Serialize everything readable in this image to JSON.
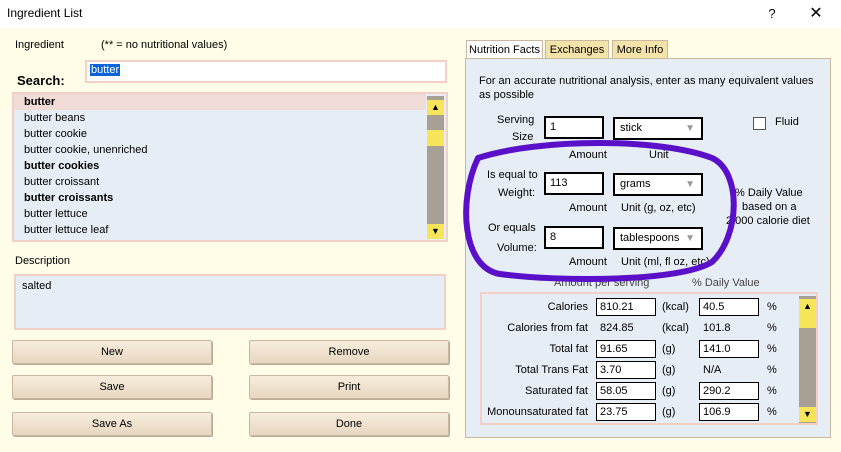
{
  "window": {
    "title": "Ingredient List",
    "help": "?",
    "close": "✕"
  },
  "ingredient_label": "Ingredient",
  "no_values_note": "(** =  no nutritional values)",
  "search_label": "Search:",
  "search_value": "butter",
  "list": [
    {
      "text": "butter",
      "bold": true,
      "selected": true
    },
    {
      "text": "butter beans",
      "bold": false,
      "selected": false
    },
    {
      "text": "butter cookie",
      "bold": false,
      "selected": false
    },
    {
      "text": "butter cookie, unenriched",
      "bold": false,
      "selected": false
    },
    {
      "text": "butter cookies",
      "bold": true,
      "selected": false
    },
    {
      "text": "butter croissant",
      "bold": false,
      "selected": false
    },
    {
      "text": "butter croissants",
      "bold": true,
      "selected": false
    },
    {
      "text": "butter lettuce",
      "bold": false,
      "selected": false
    },
    {
      "text": "butter lettuce leaf",
      "bold": false,
      "selected": false
    }
  ],
  "description_label": "Description",
  "description_value": "salted",
  "buttons": {
    "new": "New",
    "remove": "Remove",
    "save": "Save",
    "print": "Print",
    "save_as": "Save As",
    "done": "Done"
  },
  "tabs": [
    "Nutrition Facts",
    "Exchanges",
    "More Info"
  ],
  "nutrition": {
    "intro": "For an accurate nutritional analysis, enter as many equivalent values",
    "intro2": "as possible",
    "serving_label1": "Serving",
    "serving_label2": "Size",
    "serving_amount": "1",
    "serving_unit": "stick",
    "fluid_label": "Fluid",
    "amount_caption": "Amount",
    "unit_caption": "Unit",
    "weight_label1": "Is equal to",
    "weight_label2": "Weight:",
    "weight_amount": "113",
    "weight_unit": "grams",
    "weight_unit_caption": "Unit (g, oz, etc)",
    "volume_label1": "Or equals",
    "volume_label2": "Volume:",
    "volume_amount": "8",
    "volume_unit": "tablespoons",
    "volume_unit_caption": "Unit (ml, fl oz, etc)",
    "dv_note1": "% Daily Value",
    "dv_note2": "based on a",
    "dv_note3": "2,000 calorie diet",
    "amount_per_serving": "Amount per serving",
    "pct_daily_value": "% Daily Value",
    "rows": [
      {
        "name": "Calories",
        "value": "810.21",
        "unit": "(kcal)",
        "dv": "40.5",
        "pct": "%",
        "boxed": true
      },
      {
        "name": "Calories from fat",
        "value": "824.85",
        "unit": "(kcal)",
        "dv": "101.8",
        "pct": "%",
        "boxed": false
      },
      {
        "name": "Total fat",
        "value": "91.65",
        "unit": "(g)",
        "dv": "141.0",
        "pct": "%",
        "boxed": true
      },
      {
        "name": "Total Trans Fat",
        "value": "3.70",
        "unit": "(g)",
        "dv": "N/A",
        "pct": "%",
        "boxed": "value"
      },
      {
        "name": "Saturated fat",
        "value": "58.05",
        "unit": "(g)",
        "dv": "290.2",
        "pct": "%",
        "boxed": true
      },
      {
        "name": "Monounsaturated fat",
        "value": "23.75",
        "unit": "(g)",
        "dv": "106.9",
        "pct": "%",
        "boxed": true
      }
    ]
  },
  "colors": {
    "annotation": "#5a0fc8",
    "background": "#fffde7",
    "panel": "#e6edf5",
    "selection": "#0a63d8"
  },
  "annotation": {
    "shape": "hand-drawn-ellipse",
    "color": "#5a0fc8"
  }
}
